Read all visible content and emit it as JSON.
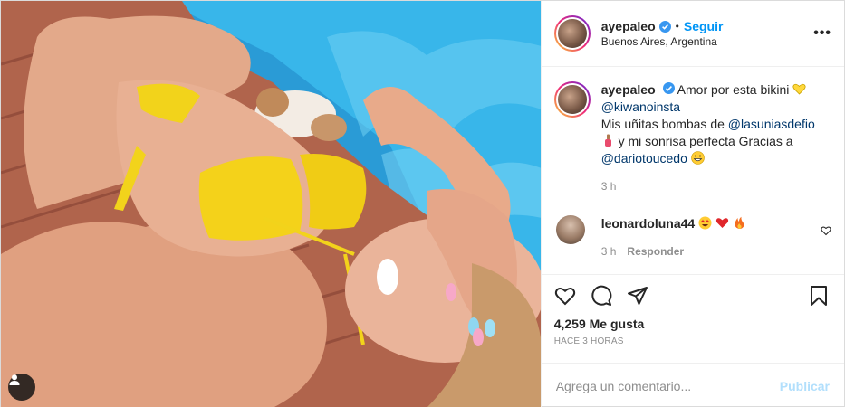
{
  "post": {
    "photo": {
      "alt_icon": "user-tags-icon"
    },
    "header": {
      "username": "ayepaleo",
      "separator": "•",
      "follow_label": "Seguir",
      "location": "Buenos Aires, Argentina",
      "more_label": "•••"
    },
    "caption": {
      "username": "ayepaleo",
      "text1": " Amor por esta bikini ",
      "mention1": "@kiwanoinsta",
      "text2": "Mis uñitas bombas de ",
      "mention2": "@lasuniasdefio",
      "text3": " y mi sonrisa perfecta Gracias a ",
      "mention3": "@dariotoucedo",
      "time": "3 h"
    },
    "reply": {
      "username": "leonardoluna44",
      "time": "3 h",
      "reply_label": "Responder"
    },
    "likes_text": "4,259 Me gusta",
    "posted_ago": "HACE 3 HORAS",
    "comment_box": {
      "placeholder": "Agrega un comentario...",
      "publish_label": "Publicar"
    },
    "colors": {
      "link": "#00376b",
      "follow": "#0095f6",
      "publish_disabled": "#b2dffc",
      "verified": "#3897f0"
    }
  }
}
